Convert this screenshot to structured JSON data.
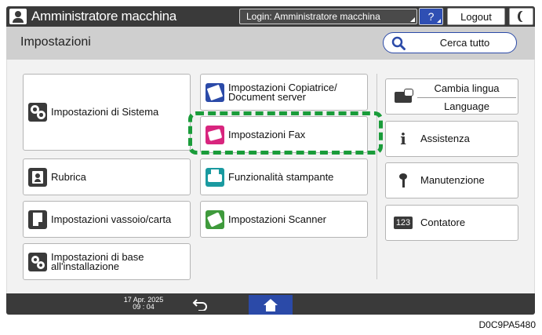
{
  "topbar": {
    "title": "Amministratore macchina",
    "login": "Login: Amministratore macchina",
    "help_label": "?",
    "logout_label": "Logout"
  },
  "header": {
    "page_title": "Impostazioni",
    "search_label": "Cerca tutto"
  },
  "tiles": {
    "system": "Impostazioni di Sistema",
    "copier_line1": "Impostazioni Copiatrice/",
    "copier_line2": "Document server",
    "fax": "Impostazioni Fax",
    "address_book": "Rubrica",
    "printer": "Funzionalità stampante",
    "tray_paper": "Impostazioni vassoio/carta",
    "scanner": "Impostazioni Scanner",
    "basic_line1": "Impostazioni di base",
    "basic_line2": "all'installazione"
  },
  "side": {
    "lang_top": "Cambia lingua",
    "lang_bottom": "Language",
    "assist": "Assistenza",
    "maintenance": "Manutenzione",
    "counter": "Contatore",
    "counter_badge": "123"
  },
  "bottombar": {
    "date": "17 Apr. 2025",
    "time": "09 : 04"
  },
  "figure_code": "D0C9PA5480",
  "colors": {
    "accent": "#2b4aa8",
    "highlight": "#1a9c3a"
  }
}
